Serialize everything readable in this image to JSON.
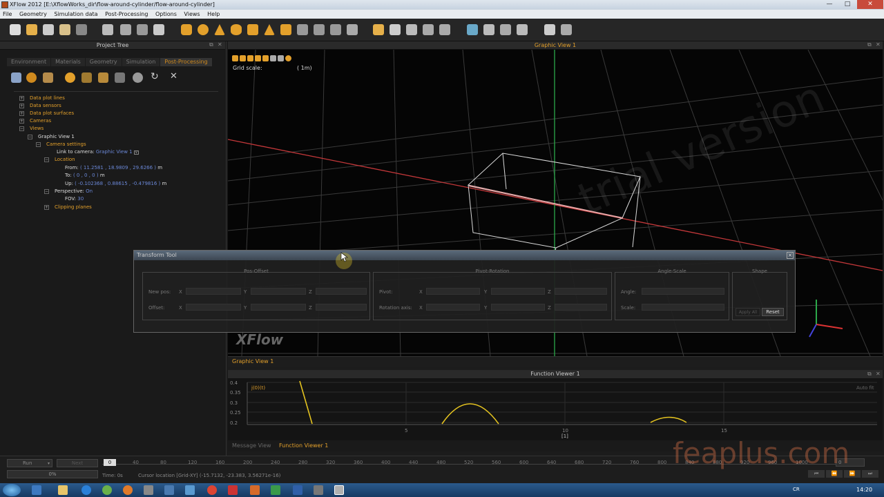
{
  "window": {
    "title": "XFlow 2012 [E:\\XflowWorks_dir\\flow-around-cylinder/flow-around-cylinder]",
    "minimize": "—",
    "maximize": "□",
    "close": "✕"
  },
  "menu": [
    "File",
    "Geometry",
    "Simulation data",
    "Post-Processing",
    "Options",
    "Views",
    "Help"
  ],
  "project_tree": {
    "title": "Project Tree",
    "tabs": [
      "Environment",
      "Materials",
      "Geometry",
      "Simulation",
      "Post-Processing"
    ],
    "active_tab": "Post-Processing",
    "nodes": {
      "data_plot_lines": "Data plot lines",
      "data_sensors": "Data sensors",
      "data_plot_surfaces": "Data plot surfaces",
      "cameras": "Cameras",
      "views": "Views",
      "graphic_view_1": "Graphic View 1",
      "camera_settings": "Camera settings",
      "link_to_camera_label": "Link to camera:",
      "link_to_camera_value": "Graphic View 1",
      "location": "Location",
      "from_label": "From:",
      "from_values": "( 11.2581 , 18.9809 , 29.6266 )",
      "to_label": "To:",
      "to_values": "( 0 , 0 , 0 )",
      "up_label": "Up:",
      "up_values": "( -0.102368 , 0.88615 , -0.479816 )",
      "unit_m": "m",
      "perspective_label": "Perspective:",
      "perspective_value": "On",
      "fov_label": "FOV:",
      "fov_value": "30",
      "clipping_planes": "Clipping planes"
    }
  },
  "graphic_view": {
    "title": "Graphic View 1",
    "grid_scale_label": "Grid scale:",
    "grid_scale_value": "( 1m)",
    "watermark": "trial version",
    "logo": "XFlow",
    "footer_tab": "Graphic View 1"
  },
  "transform_tool": {
    "title": "Transform Tool",
    "close": "×",
    "pos_offset": {
      "title": "Pos-Offset",
      "new_pos": "New pos:",
      "offset": "Offset:"
    },
    "pivot_rotation": {
      "title": "Pivot-Rotation",
      "pivot": "Pivot:",
      "rotation_axis": "Rotation axis:"
    },
    "angle_scale": {
      "title": "Angle-Scale",
      "angle": "Angle:",
      "scale": "Scale:"
    },
    "shape": {
      "title": "Shape",
      "apply": "Apply All",
      "reset": "Reset"
    },
    "axes": [
      "X",
      "Y",
      "Z"
    ]
  },
  "function_viewer": {
    "title": "Function Viewer 1",
    "series_label": "j(0)(t)",
    "auto_fit": "Auto fit",
    "y_ticks": [
      "0.4",
      "0.35",
      "0.3",
      "0.25",
      "0.2"
    ],
    "x_ticks": [
      "5",
      "10",
      "15"
    ],
    "x_unit": "[1]"
  },
  "bottom_tabs": [
    "Message View",
    "Function Viewer 1"
  ],
  "active_bottom_tab": "Function Viewer 1",
  "timeline": {
    "run_select": "Run",
    "next_button": "Next",
    "progress_value": "0%",
    "start_value": "0",
    "ticks": [
      "40",
      "80",
      "120",
      "160",
      "200",
      "240",
      "280",
      "320",
      "360",
      "400",
      "440",
      "480",
      "520",
      "560",
      "600",
      "640",
      "680",
      "720",
      "760",
      "800",
      "840",
      "880",
      "920",
      "960",
      "1000"
    ],
    "time_label": "Time: 0s",
    "cursor_location": "Cursor location [Grid-XY] (-15.7132, -23.383, 3.56271e-16)",
    "frame_value": "0"
  },
  "taskbar": {
    "clock": "14:20",
    "lang": "CR"
  },
  "watermark": "feaplus.com",
  "colors": {
    "accent": "#e3a02b",
    "link_blue": "#6b88d8",
    "bg": "#1a1a1a"
  }
}
